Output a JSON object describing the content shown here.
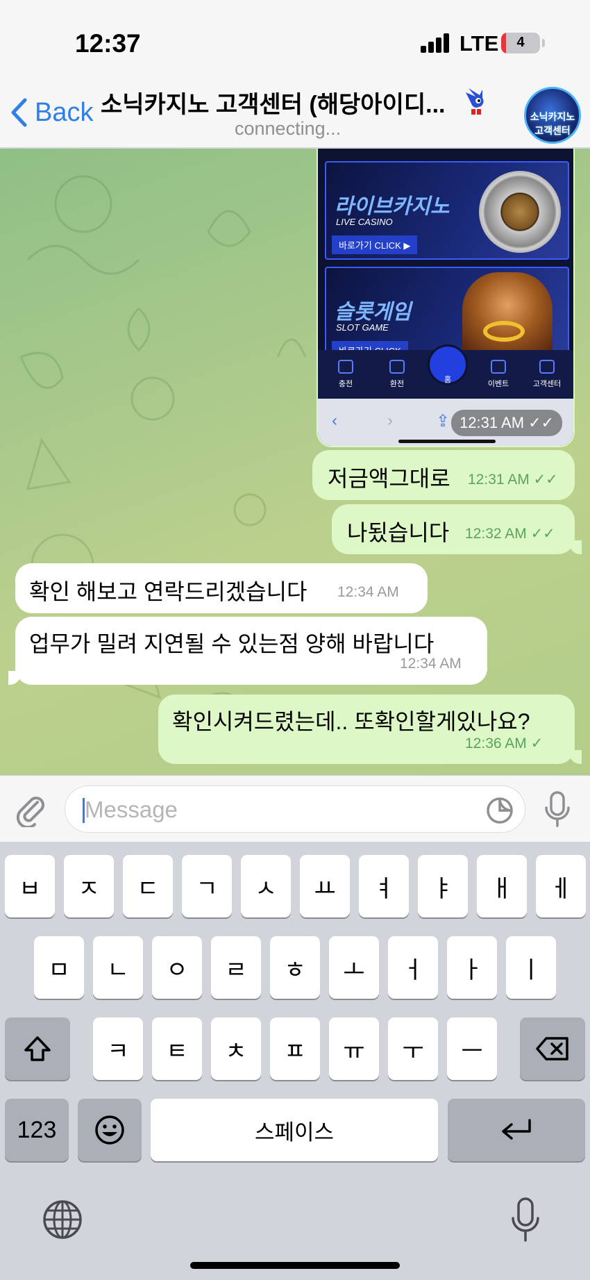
{
  "status_bar": {
    "time": "12:37",
    "network": "LTE",
    "battery_level": "4",
    "battery_fraction": 0.12
  },
  "header": {
    "back_label": "Back",
    "title": "소닉카지노 고객센터 (해당아이디...",
    "subtitle": "connecting...",
    "avatar_text": "소닉카지노 고객센터"
  },
  "screenshot_message": {
    "banners": [
      {
        "title": "라이브카지노",
        "subtitle": "LIVE CASINO",
        "button": "바로가기 CLICK ▶"
      },
      {
        "title": "슬롯게임",
        "subtitle": "SLOT GAME",
        "button": "바로가기 CLICK"
      }
    ],
    "nav": [
      "충전",
      "환전",
      "홈",
      "이벤트",
      "고객센터"
    ],
    "time": "12:31 AM"
  },
  "messages": [
    {
      "direction": "out",
      "text": "저금액그대로",
      "time": "12:31 AM",
      "status": "read"
    },
    {
      "direction": "out",
      "text": "나됬습니다",
      "time": "12:32 AM",
      "status": "read"
    },
    {
      "direction": "in",
      "text": "확인 해보고 연락드리겠습니다",
      "time": "12:34 AM"
    },
    {
      "direction": "in",
      "text": "업무가 밀려 지연될 수 있는점  양해 바랍니다",
      "time": "12:34 AM"
    },
    {
      "direction": "out",
      "text": "확인시켜드렸는데.. 또확인할게있나요?",
      "time": "12:36 AM",
      "status": "sent"
    }
  ],
  "composer": {
    "placeholder": "Message",
    "value": ""
  },
  "keyboard": {
    "row1": [
      "ㅂ",
      "ㅈ",
      "ㄷ",
      "ㄱ",
      "ㅅ",
      "ㅛ",
      "ㅕ",
      "ㅑ",
      "ㅐ",
      "ㅔ"
    ],
    "row2": [
      "ㅁ",
      "ㄴ",
      "ㅇ",
      "ㄹ",
      "ㅎ",
      "ㅗ",
      "ㅓ",
      "ㅏ",
      "ㅣ"
    ],
    "row3": [
      "ㅋ",
      "ㅌ",
      "ㅊ",
      "ㅍ",
      "ㅠ",
      "ㅜ",
      "ㅡ"
    ],
    "numbers_key": "123",
    "space_label": "스페이스"
  },
  "icons": [
    "back-chevron-icon",
    "sonic-icon",
    "attach-icon",
    "sticker-icon",
    "mic-icon",
    "shift-icon",
    "backspace-icon",
    "emoji-icon",
    "return-icon",
    "globe-icon",
    "dictation-icon"
  ],
  "colors": {
    "accent": "#2f7fe6",
    "outgoing_bubble": "#ddf8c6",
    "incoming_bubble": "#ffffff",
    "read_check": "#5aa45a"
  }
}
